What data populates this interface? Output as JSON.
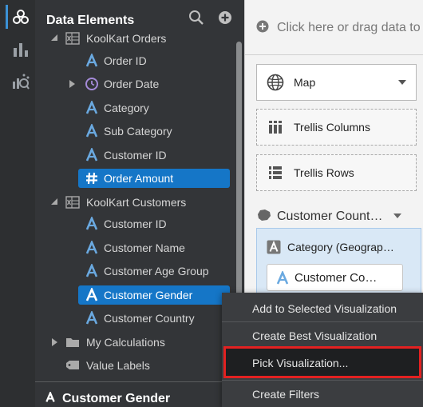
{
  "rail": {
    "icons": [
      "data-icon",
      "visualizations-icon",
      "analytics-icon"
    ]
  },
  "panel": {
    "title": "Data Elements",
    "tree": [
      {
        "label": "KoolKart Orders",
        "kind": "dataset",
        "expanded": true
      },
      {
        "label": "Order ID",
        "kind": "attribute"
      },
      {
        "label": "Order Date",
        "kind": "time",
        "collapsed": true
      },
      {
        "label": "Category",
        "kind": "attribute"
      },
      {
        "label": "Sub Category",
        "kind": "attribute"
      },
      {
        "label": "Customer ID",
        "kind": "attribute"
      },
      {
        "label": "Order Amount",
        "kind": "measure",
        "selected": true
      },
      {
        "label": "KoolKart Customers",
        "kind": "dataset",
        "expanded": true
      },
      {
        "label": "Customer ID",
        "kind": "attribute"
      },
      {
        "label": "Customer Name",
        "kind": "attribute"
      },
      {
        "label": "Customer Age Group",
        "kind": "attribute"
      },
      {
        "label": "Customer Gender",
        "kind": "attribute",
        "selected": true
      },
      {
        "label": "Customer Country",
        "kind": "attribute"
      },
      {
        "label": "My Calculations",
        "kind": "folder",
        "collapsed": true
      },
      {
        "label": "Value Labels",
        "kind": "tag"
      }
    ],
    "bottom_title": "Customer Gender"
  },
  "grammar": {
    "drop_hint": "Click here or drag data to",
    "viz_type": "Map",
    "trellis_columns": "Trellis Columns",
    "trellis_rows": "Trellis Rows",
    "section_title": "Customer Count…",
    "category_label": "Category (Geograp…",
    "category_chip": "Customer Co…"
  },
  "context_menu": {
    "items": [
      {
        "label": "Add to Selected Visualization"
      },
      {
        "label": "Create Best Visualization"
      },
      {
        "label": "Pick Visualization...",
        "highlighted": true
      },
      {
        "label": "Create Filters"
      }
    ]
  },
  "colors": {
    "selection": "#1576c7",
    "attribute_icon": "#6aa9e0",
    "highlight_border": "#e32121",
    "panel_bg": "#333538"
  }
}
